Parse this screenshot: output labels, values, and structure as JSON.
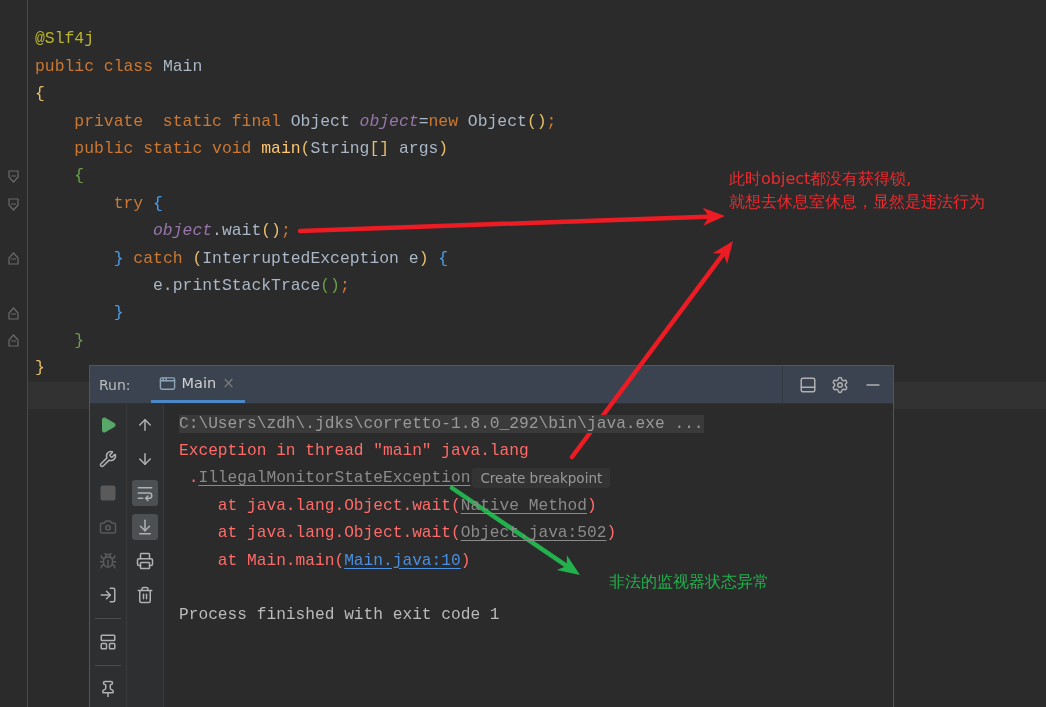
{
  "editor": {
    "lines": [
      {
        "kind": "code",
        "tokens": [
          {
            "kind": "annotation",
            "text": "@Slf4j"
          }
        ]
      },
      {
        "kind": "code",
        "tokens": [
          {
            "kind": "keyword",
            "text": "public class "
          },
          {
            "kind": "text",
            "text": "Main"
          }
        ]
      },
      {
        "kind": "code",
        "tokens": [
          {
            "kind": "bracket1",
            "text": "{"
          }
        ]
      },
      {
        "kind": "code",
        "tokens": [
          {
            "kind": "keyword",
            "text": "    private  static final "
          },
          {
            "kind": "text",
            "text": "Object "
          },
          {
            "kind": "field",
            "text": "object"
          },
          {
            "kind": "text",
            "text": "="
          },
          {
            "kind": "keyword",
            "text": "new "
          },
          {
            "kind": "text",
            "text": "Object"
          },
          {
            "kind": "bracket1",
            "text": "()"
          },
          {
            "kind": "keyword",
            "text": ";"
          }
        ]
      },
      {
        "kind": "code",
        "tokens": [
          {
            "kind": "keyword",
            "text": "    public static void "
          },
          {
            "kind": "method",
            "text": "main"
          },
          {
            "kind": "bracket1",
            "text": "("
          },
          {
            "kind": "text",
            "text": "String"
          },
          {
            "kind": "bracket1",
            "text": "[]"
          },
          {
            "kind": "text",
            "text": " args"
          },
          {
            "kind": "bracket1",
            "text": ")"
          }
        ]
      },
      {
        "kind": "fold_start",
        "tokens": [
          {
            "kind": "bracket2",
            "text": "    {"
          }
        ]
      },
      {
        "kind": "fold_start",
        "tokens": [
          {
            "kind": "keyword",
            "text": "        try "
          },
          {
            "kind": "bracket3",
            "text": "{"
          }
        ]
      },
      {
        "kind": "code",
        "tokens": [
          {
            "kind": "field",
            "text": "            object"
          },
          {
            "kind": "text",
            "text": ".wait"
          },
          {
            "kind": "bracket1",
            "text": "()"
          },
          {
            "kind": "keyword",
            "text": ";"
          }
        ]
      },
      {
        "kind": "fold_end",
        "tokens": [
          {
            "kind": "bracket3",
            "text": "        }"
          },
          {
            "kind": "keyword",
            "text": " catch "
          },
          {
            "kind": "bracket1",
            "text": "("
          },
          {
            "kind": "text",
            "text": "InterruptedException e"
          },
          {
            "kind": "bracket1",
            "text": ")"
          },
          {
            "kind": "bracket3",
            "text": " {"
          }
        ]
      },
      {
        "kind": "code",
        "tokens": [
          {
            "kind": "text",
            "text": "            e.printStackTrace"
          },
          {
            "kind": "bracket2",
            "text": "()"
          },
          {
            "kind": "keyword",
            "text": ";"
          }
        ]
      },
      {
        "kind": "fold_end",
        "tokens": [
          {
            "kind": "bracket3",
            "text": "        }"
          }
        ]
      },
      {
        "kind": "fold_end",
        "tokens": [
          {
            "kind": "bracket2",
            "text": "    }"
          }
        ]
      },
      {
        "kind": "code",
        "tokens": [
          {
            "kind": "bracket1",
            "text": "}"
          }
        ]
      },
      {
        "kind": "caret"
      }
    ]
  },
  "run_panel": {
    "label": "Run:",
    "tabs": [
      {
        "label": "Main",
        "selected": true,
        "close": "×"
      }
    ],
    "left_toolbar": [
      {
        "kind": "run",
        "disabled": false
      },
      {
        "kind": "wrench",
        "disabled": false
      },
      {
        "kind": "stop",
        "disabled": true
      },
      {
        "kind": "camera",
        "disabled": true
      },
      {
        "kind": "bug",
        "disabled": true
      },
      {
        "kind": "exit",
        "disabled": false
      },
      {
        "kind": "separator"
      },
      {
        "kind": "layout",
        "disabled": false
      },
      {
        "kind": "separator"
      },
      {
        "kind": "pin",
        "disabled": false
      }
    ],
    "right_toolbar": [
      {
        "kind": "up",
        "selected": false
      },
      {
        "kind": "down",
        "selected": false
      },
      {
        "kind": "wrap",
        "selected": true
      },
      {
        "kind": "scroll",
        "selected": true
      },
      {
        "kind": "print",
        "selected": false
      },
      {
        "kind": "trash",
        "selected": false
      }
    ],
    "console": [
      {
        "kind": "text",
        "tokens": [
          {
            "kind": "command",
            "text": "C:\\Users\\zdh\\.jdks\\corretto-1.8.0_292\\bin\\java.exe ..."
          }
        ]
      },
      {
        "kind": "text",
        "tokens": [
          {
            "kind": "error",
            "text": "Exception in thread \"main\" java.lang"
          }
        ]
      },
      {
        "kind": "text",
        "tokens": [
          {
            "kind": "error",
            "text": " ."
          },
          {
            "kind": "link",
            "text": "IllegalMonitorStateException"
          },
          {
            "kind": "hint",
            "text": "Create breakpoint"
          }
        ]
      },
      {
        "kind": "text",
        "tokens": [
          {
            "kind": "error",
            "text": "    at java.lang.Object.wait("
          },
          {
            "kind": "link",
            "text": "Native Method"
          },
          {
            "kind": "error",
            "text": ")"
          }
        ]
      },
      {
        "kind": "text",
        "tokens": [
          {
            "kind": "error",
            "text": "    at java.lang.Object.wait("
          },
          {
            "kind": "link",
            "text": "Object.java:502"
          },
          {
            "kind": "error",
            "text": ")"
          }
        ]
      },
      {
        "kind": "text",
        "tokens": [
          {
            "kind": "error",
            "text": "    at Main.main("
          },
          {
            "kind": "hyperlink",
            "text": "Main.java:10"
          },
          {
            "kind": "error",
            "text": ")"
          }
        ]
      },
      {
        "kind": "blank"
      },
      {
        "kind": "text",
        "tokens": [
          {
            "kind": "plain",
            "text": "Process finished with exit code 1"
          }
        ]
      }
    ]
  },
  "annotations": [
    {
      "color": "#ee2a2e",
      "lines": [
        "此时object都没有获得锁,",
        "就想去休息室休息，显然是违法行为"
      ]
    },
    {
      "color": "#22b14c",
      "lines": [
        "非法的监视器状态异常"
      ]
    }
  ],
  "arrows": [
    {
      "color": "#ed1c24"
    },
    {
      "color": "#ed1c24"
    },
    {
      "color": "#22b14c"
    }
  ]
}
